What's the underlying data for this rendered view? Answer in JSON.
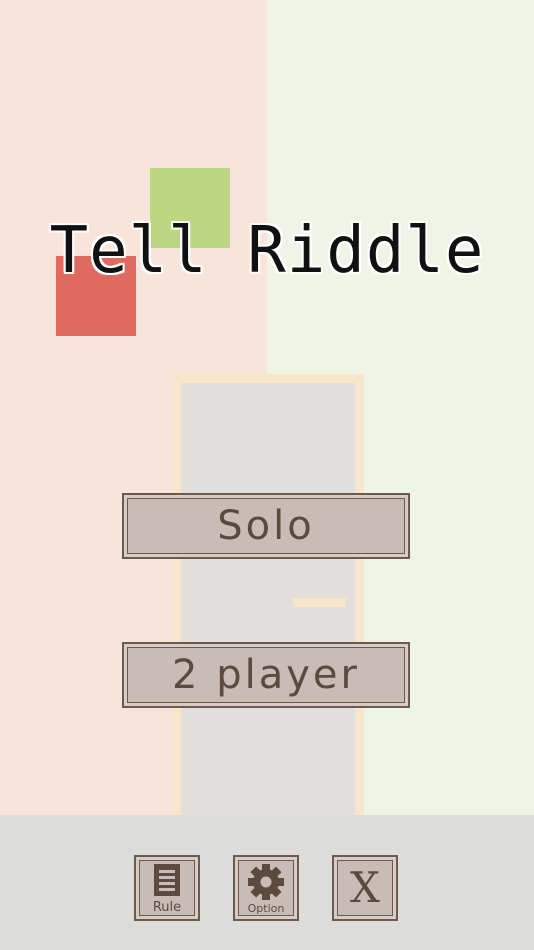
{
  "title": "Tell Riddle",
  "menu": {
    "solo_label": "Solo",
    "two_player_label": "2 player"
  },
  "toolbar": {
    "rule_label": "Rule",
    "option_label": "Option",
    "close_label": "X"
  },
  "colors": {
    "left_bg": "#f9e4dc",
    "right_bg": "#eef4e6",
    "green_square": "#bcd682",
    "red_square": "#e06a62",
    "button_fill": "#c9bbb7",
    "button_text": "#5d4a3e"
  }
}
